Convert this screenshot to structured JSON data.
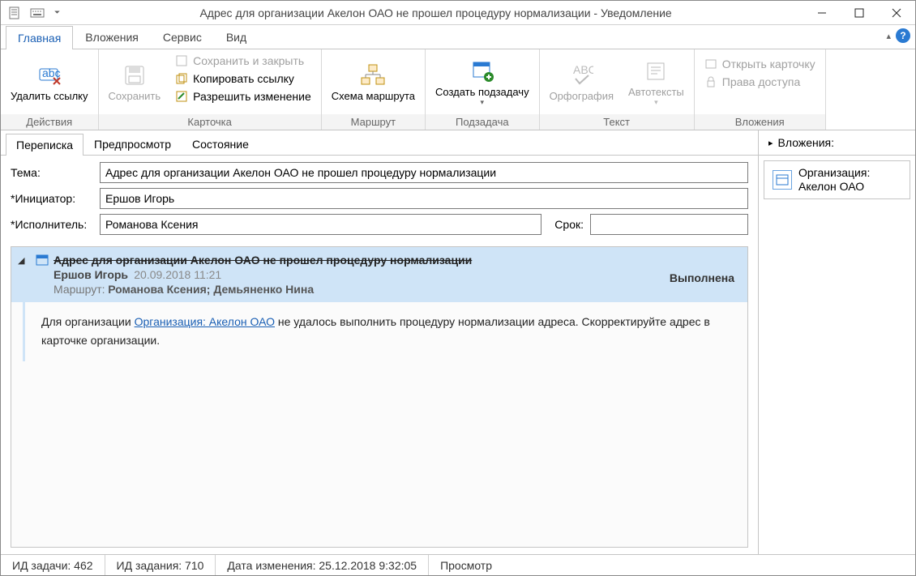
{
  "window": {
    "title": "Адрес для организации Акелон ОАО не прошел процедуру нормализации - Уведомление"
  },
  "ribbon_tabs": [
    "Главная",
    "Вложения",
    "Сервис",
    "Вид"
  ],
  "ribbon": {
    "actions": {
      "delete_link": "Удалить ссылку",
      "group": "Действия"
    },
    "card": {
      "save": "Сохранить",
      "save_close": "Сохранить и закрыть",
      "copy_link": "Копировать ссылку",
      "allow_edit": "Разрешить изменение",
      "group": "Карточка"
    },
    "route": {
      "scheme": "Схема маршрута",
      "group": "Маршрут"
    },
    "subtask": {
      "create": "Создать подзадачу",
      "group": "Подзадача"
    },
    "text": {
      "spell": "Орфография",
      "autotext": "Автотексты",
      "group": "Текст"
    },
    "attach": {
      "open_card": "Открыть карточку",
      "rights": "Права доступа",
      "group": "Вложения"
    }
  },
  "content_tabs": [
    "Переписка",
    "Предпросмотр",
    "Состояние"
  ],
  "attachments_header": "Вложения:",
  "form": {
    "subject_label": "Тема:",
    "subject": "Адрес для организации Акелон ОАО не прошел процедуру нормализации",
    "initiator_label": "*Инициатор:",
    "initiator": "Ершов Игорь",
    "executor_label": "*Исполнитель:",
    "executor": "Романова Ксения",
    "deadline_label": "Срок:",
    "deadline": ""
  },
  "thread": {
    "title": "Адрес для организации Акелон ОАО не прошел процедуру нормализации",
    "author": "Ершов Игорь",
    "timestamp": "20.09.2018 11:21",
    "status": "Выполнена",
    "route_label": "Маршрут:",
    "route": "Романова Ксения; Демьяненко Нина",
    "body_before": "Для организации ",
    "body_link": "Организация: Акелон ОАО",
    "body_after": " не удалось выполнить процедуру нормализации адреса. Скорректируйте адрес в карточке организации."
  },
  "attachments": {
    "item_line1": "Организация:",
    "item_line2": "Акелон ОАО"
  },
  "status": {
    "task_id": "ИД задачи: 462",
    "assignment_id": "ИД задания: 710",
    "modified": "Дата изменения: 25.12.2018 9:32:05",
    "mode": "Просмотр"
  }
}
